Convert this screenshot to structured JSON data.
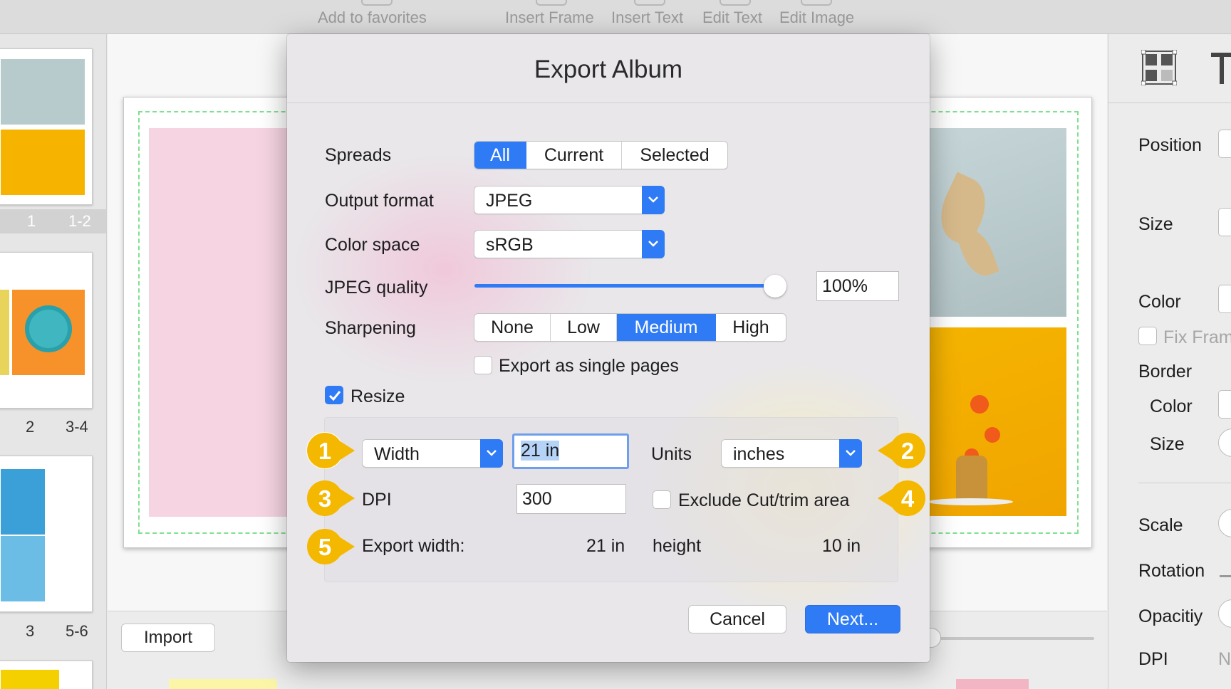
{
  "toolbar": {
    "items": [
      {
        "label": "Add to favorites",
        "icon": "star-icon"
      },
      {
        "label": "Insert Frame",
        "icon": "frame-icon"
      },
      {
        "label": "Insert Text",
        "icon": "text-icon"
      },
      {
        "label": "Edit Text",
        "icon": "edit-text-icon"
      },
      {
        "label": "Edit Image",
        "icon": "edit-image-icon"
      }
    ]
  },
  "pages": [
    {
      "number": "1",
      "range": "1-2",
      "selected": true
    },
    {
      "number": "2",
      "range": "3-4",
      "selected": false
    },
    {
      "number": "3",
      "range": "5-6",
      "selected": false
    }
  ],
  "import_label": "Import",
  "inspector": {
    "position": "Position",
    "size": "Size",
    "color": "Color",
    "fix_frame": "Fix Fram",
    "border": "Border",
    "border_color": "Color",
    "border_size": "Size",
    "scale": "Scale",
    "rotation": "Rotation",
    "opacity": "Opacitiy",
    "dpi": "DPI",
    "dpi_value": "N"
  },
  "dialog": {
    "title": "Export Album",
    "spreads": {
      "label": "Spreads",
      "options": [
        "All",
        "Current",
        "Selected"
      ],
      "selected": "All"
    },
    "output_format": {
      "label": "Output format",
      "value": "JPEG"
    },
    "color_space": {
      "label": "Color space",
      "value": "sRGB"
    },
    "jpeg_quality": {
      "label": "JPEG quality",
      "value": "100%",
      "level": 1.0
    },
    "sharpening": {
      "label": "Sharpening",
      "options": [
        "None",
        "Low",
        "Medium",
        "High"
      ],
      "selected": "Medium"
    },
    "single_pages": {
      "label": "Export as single pages",
      "checked": false
    },
    "resize": {
      "label": "Resize",
      "checked": true
    },
    "dimension": {
      "value": "Width"
    },
    "dimension_value": "21 in",
    "units": {
      "label": "Units",
      "value": "inches"
    },
    "dpi": {
      "label": "DPI",
      "value": "300"
    },
    "exclude_cut": {
      "label": "Exclude Cut/trim area",
      "checked": false
    },
    "export_width": {
      "label": "Export width:",
      "value": "21 in"
    },
    "height": {
      "label": "height",
      "value": "10 in"
    },
    "cancel_label": "Cancel",
    "next_label": "Next..."
  },
  "badges": [
    "1",
    "2",
    "3",
    "4",
    "5"
  ],
  "colors": {
    "accent": "#2f7bf5",
    "badge": "#f5b800",
    "bg": "#ececec"
  }
}
